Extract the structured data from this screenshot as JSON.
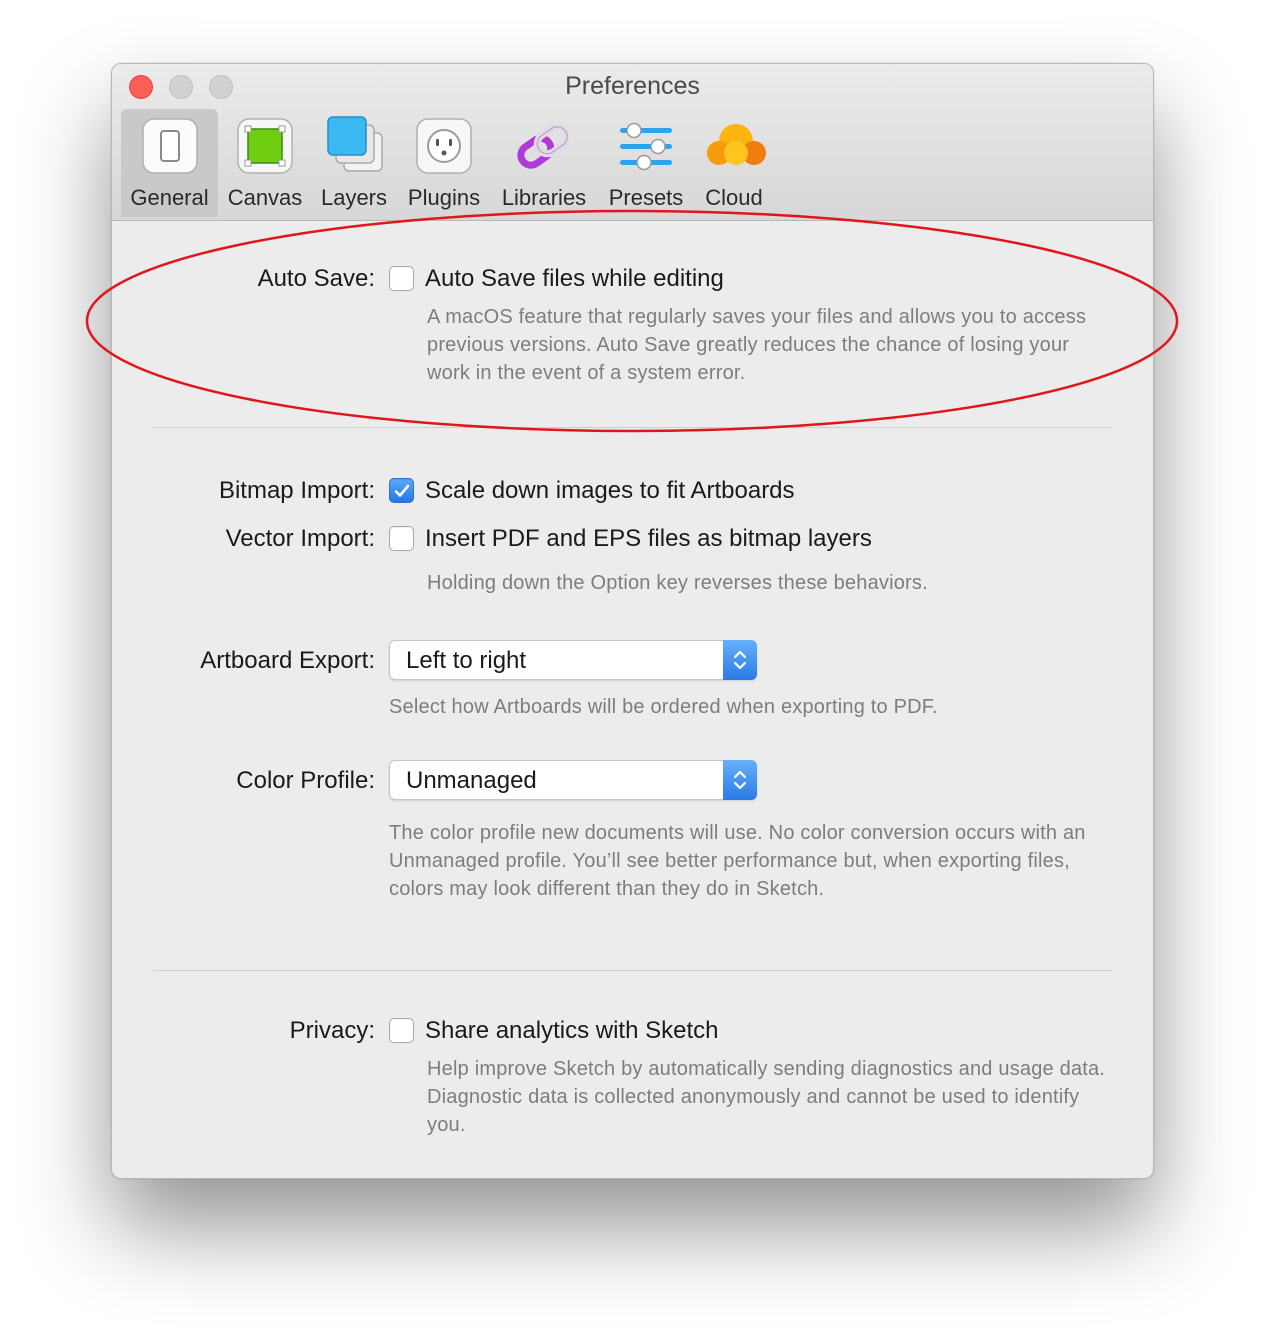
{
  "window": {
    "title": "Preferences"
  },
  "toolbar": {
    "tabs": [
      {
        "label": "General",
        "icon": "general-switch-icon",
        "active": true
      },
      {
        "label": "Canvas",
        "icon": "canvas-icon"
      },
      {
        "label": "Layers",
        "icon": "layers-icon"
      },
      {
        "label": "Plugins",
        "icon": "plugins-icon"
      },
      {
        "label": "Libraries",
        "icon": "libraries-icon"
      },
      {
        "label": "Presets",
        "icon": "presets-sliders-icon"
      },
      {
        "label": "Cloud",
        "icon": "cloud-icon"
      }
    ]
  },
  "auto_save": {
    "label": "Auto Save:",
    "option": "Auto Save files while editing",
    "checked": false,
    "description": "A macOS feature that regularly saves your files and allows you to access previous versions. Auto Save greatly reduces the chance of losing your work in the event of a system error."
  },
  "bitmap_import": {
    "label": "Bitmap Import:",
    "option": "Scale down images to fit Artboards",
    "checked": true
  },
  "vector_import": {
    "label": "Vector Import:",
    "option": "Insert PDF and EPS files as bitmap layers",
    "checked": false,
    "description": "Holding down the Option key reverses these behaviors."
  },
  "artboard_export": {
    "label": "Artboard Export:",
    "value": "Left to right",
    "description": "Select how Artboards will be ordered when exporting to PDF."
  },
  "color_profile": {
    "label": "Color Profile:",
    "value": "Unmanaged",
    "description": "The color profile new documents will use. No color conversion occurs with an Unmanaged profile. You’ll see better performance but, when exporting files, colors may look different than they do in Sketch."
  },
  "privacy": {
    "label": "Privacy:",
    "option": "Share analytics with Sketch",
    "checked": false,
    "description": "Help improve Sketch by automatically sending diagnostics and usage data. Diagnostic data is collected anonymously and cannot be used to identify you."
  },
  "colors": {
    "accent": "#2577e6",
    "annotation_ellipse": "#e0161b",
    "close_button": "#fc5f57"
  }
}
